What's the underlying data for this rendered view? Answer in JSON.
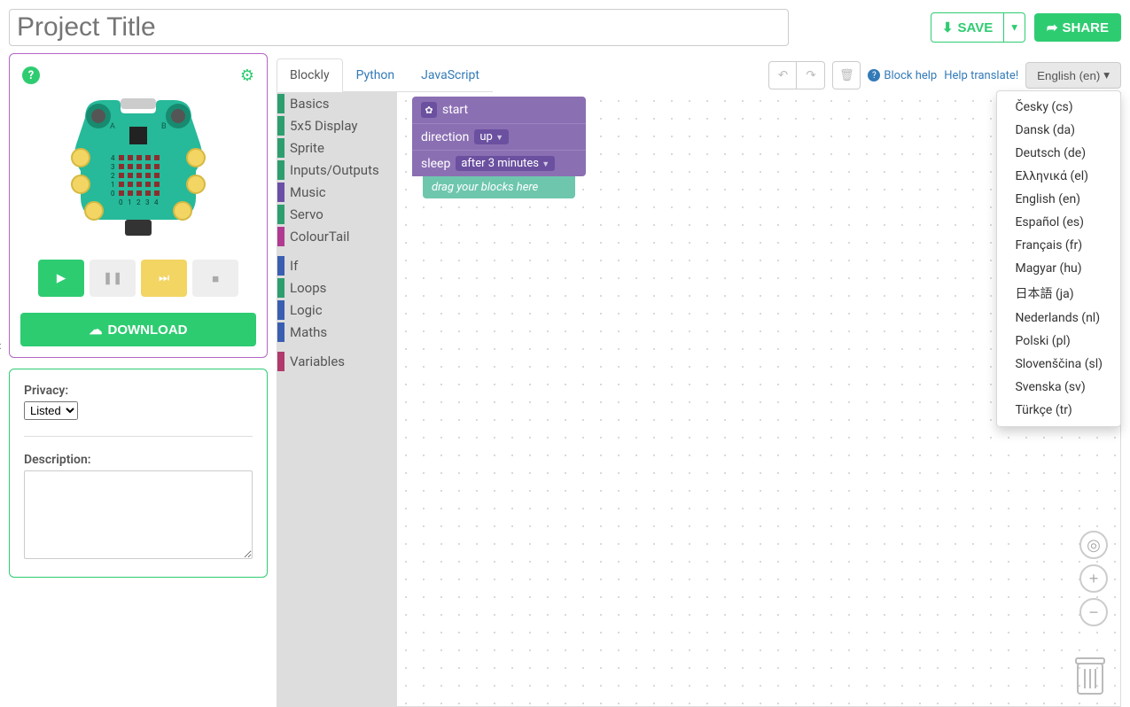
{
  "title_placeholder": "Project Title",
  "buttons": {
    "save": "SAVE",
    "share": "SHARE",
    "download": "DOWNLOAD"
  },
  "tabs": [
    {
      "label": "Blockly",
      "active": true
    },
    {
      "label": "Python",
      "active": false
    },
    {
      "label": "JavaScript",
      "active": false
    }
  ],
  "links": {
    "block_help": "Block help",
    "help_translate": "Help translate!"
  },
  "language_selected": "English (en)",
  "languages": [
    "Česky (cs)",
    "Dansk (da)",
    "Deutsch (de)",
    "Ελληνικά (el)",
    "English (en)",
    "Español (es)",
    "Français (fr)",
    "Magyar (hu)",
    "日本語 (ja)",
    "Nederlands (nl)",
    "Polski (pl)",
    "Slovenščina (sl)",
    "Svenska (sv)",
    "Türkçe (tr)"
  ],
  "toolbox": {
    "group1": [
      {
        "label": "Basics",
        "color": "#2e9e6f"
      },
      {
        "label": "5x5 Display",
        "color": "#2e9e6f"
      },
      {
        "label": "Sprite",
        "color": "#2e9e6f"
      },
      {
        "label": "Inputs/Outputs",
        "color": "#2e9e6f"
      },
      {
        "label": "Music",
        "color": "#6b4fa6"
      },
      {
        "label": "Servo",
        "color": "#2e9e6f"
      },
      {
        "label": "ColourTail",
        "color": "#b03a8f"
      }
    ],
    "group2": [
      {
        "label": "If",
        "color": "#3a5fb0"
      },
      {
        "label": "Loops",
        "color": "#2e9e6f"
      },
      {
        "label": "Logic",
        "color": "#3a5fb0"
      },
      {
        "label": "Maths",
        "color": "#3a5fb0"
      }
    ],
    "group3": [
      {
        "label": "Variables",
        "color": "#b03a6b"
      }
    ]
  },
  "blocks": {
    "start": "start",
    "direction": "direction",
    "direction_val": "up",
    "sleep": "sleep",
    "sleep_val": "after 3 minutes",
    "drag_hint": "drag your blocks here"
  },
  "device": {
    "button_a": "A",
    "button_b": "B",
    "rows": [
      "4",
      "3",
      "2",
      "1",
      "0"
    ],
    "cols": [
      "0",
      "1",
      "2",
      "3",
      "4"
    ]
  },
  "meta": {
    "privacy_label": "Privacy:",
    "privacy_value": "Listed",
    "description_label": "Description:"
  }
}
